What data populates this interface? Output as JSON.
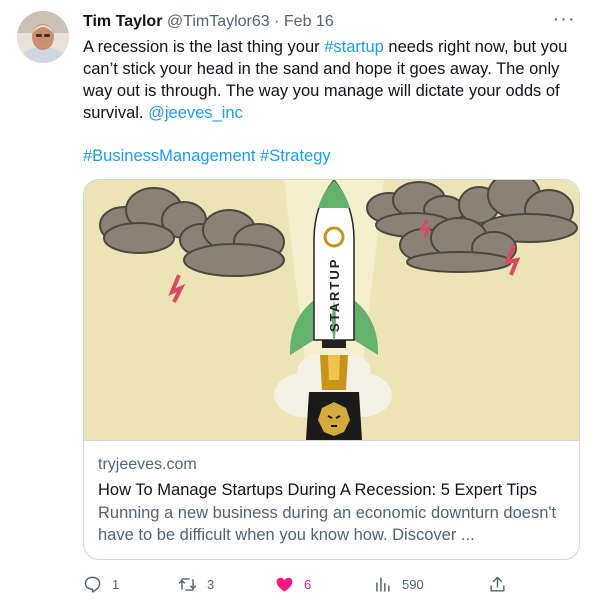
{
  "tweet": {
    "author_name": "Tim Taylor",
    "author_handle": "@TimTaylor63",
    "separator": "·",
    "date": "Feb 16",
    "more_label": "···",
    "text_part1": "A recession is the last thing your ",
    "hashtag_startup": "#startup",
    "text_part2": " needs right now, but you can’t stick your head in the sand and hope it goes away. The only way out is through. The way you manage will dictate your odds of survival. ",
    "mention": "@jeeves_inc",
    "hashtag_business": "#BusinessManagement",
    "hashtag_strategy": "#Strategy"
  },
  "card": {
    "rocket_label": "STARTUP",
    "domain": "tryjeeves.com",
    "title": "How To Manage Startups During A Recession: 5 Expert Tips",
    "description": "Running a new business during an economic downturn doesn't have to be difficult when you know how. Discover ..."
  },
  "actions": {
    "reply_count": "1",
    "retweet_count": "3",
    "like_count": "6",
    "views_count": "590"
  },
  "colors": {
    "link": "#1d9bf0",
    "like": "#f91880",
    "muted": "#536471"
  }
}
